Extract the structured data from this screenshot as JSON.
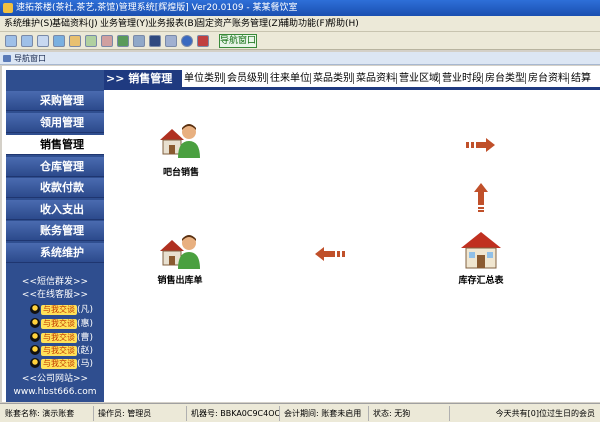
{
  "window": {
    "title": "速拓茶楼(茶社,茶艺,茶馆)管理系统[辉煌版] Ver20.0109 - 某某餐饮室"
  },
  "menubar": {
    "items": [
      "系统维护(S)",
      "基础资料(J)",
      "业务管理(Y)",
      "业务报表(B)",
      "固定资产",
      "账务管理(Z)",
      "辅助功能(F)",
      "帮助(H)"
    ]
  },
  "toolbar": {
    "nav_window_label": "导航窗口"
  },
  "subwindow": {
    "title": "导航窗口"
  },
  "sidebar": {
    "items": [
      "采购管理",
      "领用管理",
      "销售管理",
      "仓库管理",
      "收款付款",
      "收入支出",
      "账务管理",
      "系统维护"
    ],
    "active_index": 2,
    "sms_link": "<<短信群发>>",
    "service_link": "<<在线客服>>",
    "qq_label": "与我交谈",
    "qq_contacts": [
      "(凡)",
      "(惠)",
      "(曹)",
      "(赵)",
      "(马)"
    ],
    "company_link": "<<公司网站>>",
    "website": "www.hbst666.com"
  },
  "tabbar": {
    "header": ">> 销售管理",
    "tabs": [
      "单位类别",
      "会员级别",
      "往来单位",
      "菜品类别",
      "菜品资料",
      "营业区域",
      "营业时段",
      "房台类型",
      "房台资料",
      "结算"
    ]
  },
  "modules": {
    "bar_sales": "吧台销售",
    "sales_outbound": "销售出库单",
    "inventory_summary": "库存汇总表"
  },
  "status": {
    "account": "账套名称: 演示账套",
    "operator": "操作员: 管理员",
    "machine": "机器号: BBKA0C9C4OC5(",
    "period": "会计期间: 账套未启用",
    "state": "状态: 无狗",
    "birthday": "今天共有[0]位过生日的会员"
  },
  "colors": {
    "sidebar": "#2f4e8f",
    "tab_header": "#1f3a80",
    "arrow": "#c0502a"
  }
}
